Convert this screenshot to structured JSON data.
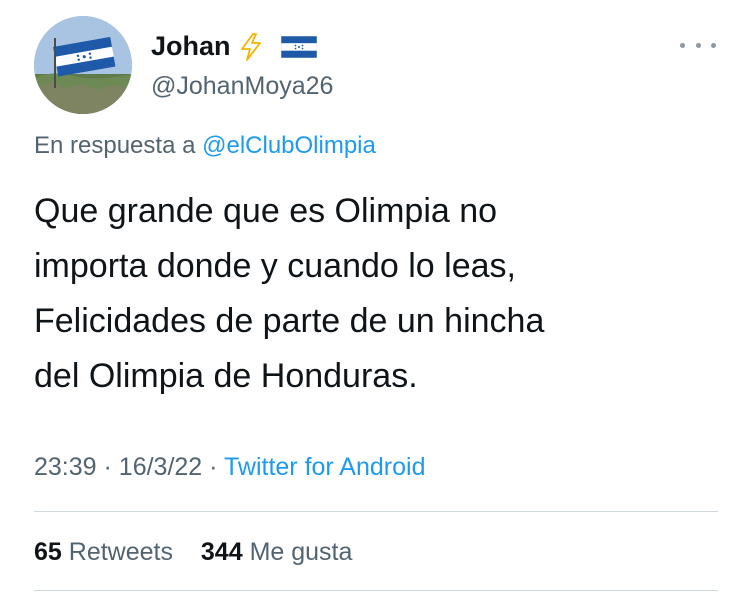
{
  "author": {
    "display_name": "Johan",
    "handle": "@JohanMoya26",
    "name_icons": [
      "lightning-bolt-icon",
      "honduras-flag-icon"
    ]
  },
  "reply": {
    "prefix": "En respuesta a",
    "mention": "@elClubOlimpia"
  },
  "tweet": {
    "lines": [
      "Que grande que es Olimpia no",
      "importa donde y cuando lo leas,",
      "Felicidades de parte de un hincha",
      "del Olimpia de Honduras."
    ]
  },
  "meta": {
    "time": "23:39",
    "separator": "·",
    "date": "16/3/22",
    "source": "Twitter for Android"
  },
  "stats": {
    "retweets_count": "65",
    "retweets_label": "Retweets",
    "likes_count": "344",
    "likes_label": "Me gusta"
  },
  "colors": {
    "text": "#0f1419",
    "secondary": "#536471",
    "link": "#1d9bf0",
    "divider": "#cfd9de",
    "bolt": "#f4b400",
    "flag_blue": "#1e5aa8"
  }
}
